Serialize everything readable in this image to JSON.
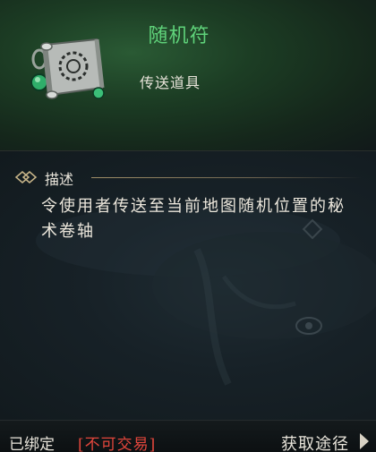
{
  "item": {
    "name": "随机符",
    "type": "传送道具",
    "icon": "scroll-icon",
    "name_color": "#5fd27a"
  },
  "description": {
    "label": "描述",
    "text": "令使用者传送至当前地图随机位置的秘术卷轴"
  },
  "footer": {
    "bound": "已绑定",
    "trade": "[不可交易]",
    "trade_color": "#e2463c",
    "source": "获取途径"
  }
}
